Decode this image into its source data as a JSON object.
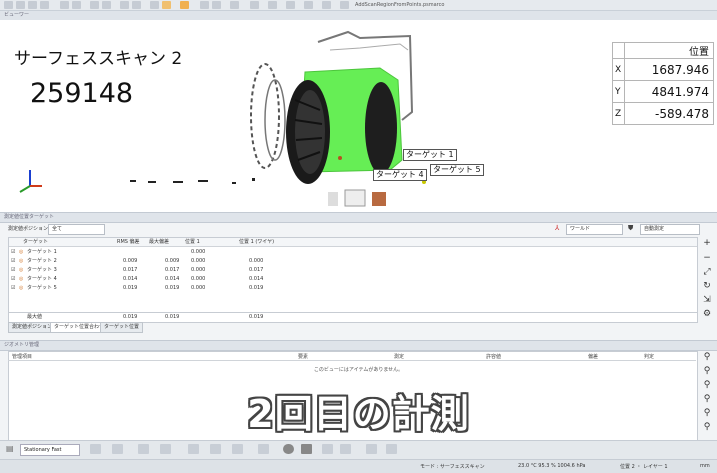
{
  "window": {
    "filename": "AddScanRegionFromPoints.psmarco"
  },
  "viewport": {
    "panel_title": "ビューワー",
    "scan_title": "サーフェススキャン 2",
    "scan_count": "259148",
    "position": {
      "header": "位置",
      "rows": [
        {
          "axis": "X",
          "value": "1687.946"
        },
        {
          "axis": "Y",
          "value": "4841.974"
        },
        {
          "axis": "Z",
          "value": "-589.478"
        }
      ]
    },
    "target_labels": [
      "ターゲット 1",
      "ターゲット 4",
      "ターゲット 5"
    ],
    "scan_color": "#66ee55"
  },
  "inspection": {
    "panel_title": "測定値位置ターゲット",
    "filter_label": "測定値ポジション",
    "filter_value": "全て",
    "coord_value": "ワールド",
    "mode_value": "自動測定",
    "columns": [
      "ターゲット",
      "RMS 偏差",
      "最大偏差",
      "位置 1",
      "位置 1 (ワイヤ)"
    ],
    "rows": [
      {
        "name": "ターゲット 1",
        "rms": "",
        "max": "",
        "p1": "0.000",
        "p2": ""
      },
      {
        "name": "ターゲット 2",
        "rms": "0.009",
        "max": "0.009",
        "p1": "0.000",
        "p2": "0.000"
      },
      {
        "name": "ターゲット 3",
        "rms": "0.017",
        "max": "0.017",
        "p1": "0.000",
        "p2": "0.017"
      },
      {
        "name": "ターゲット 4",
        "rms": "0.014",
        "max": "0.014",
        "p1": "0.000",
        "p2": "0.014"
      },
      {
        "name": "ターゲット 5",
        "rms": "0.019",
        "max": "0.019",
        "p1": "0.000",
        "p2": "0.019"
      }
    ],
    "max_row": {
      "label": "最大値",
      "rms": "0.019",
      "max": "0.019",
      "p2": "0.019"
    },
    "tabs": [
      "測定値ポジション",
      "ターゲット位置合わせ",
      "ターゲット位置"
    ]
  },
  "bottom": {
    "panel_title": "ジオメトリ管理",
    "columns": [
      "管理項目",
      "要素",
      "測定",
      "許容値",
      "偏差",
      "判定"
    ],
    "empty_message": "このビューにはアイテムがありません。",
    "caption": "2回目の計測"
  },
  "toolbar": {
    "mode_select": "Stationary Fast"
  },
  "status": {
    "mode": "モード : サーフェススキャン",
    "env": "23.0 °C  95.3 %  1004.6 hPa",
    "position": "位置 2 ・ レイヤー 1",
    "unit": "mm"
  }
}
